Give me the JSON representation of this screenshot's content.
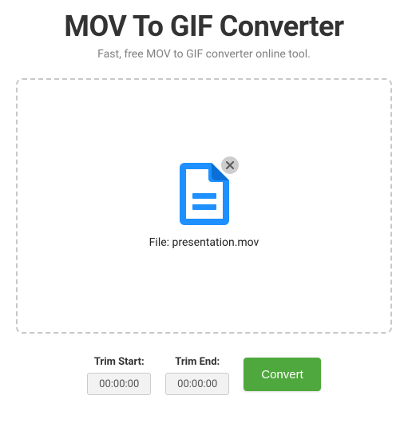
{
  "header": {
    "title": "MOV To GIF Converter",
    "subtitle": "Fast, free MOV to GIF converter online tool."
  },
  "dropzone": {
    "file_prefix": "File: ",
    "file_name": "presentation.mov"
  },
  "controls": {
    "trim_start_label": "Trim Start:",
    "trim_start_value": "00:00:00",
    "trim_end_label": "Trim End:",
    "trim_end_value": "00:00:00",
    "convert_label": "Convert"
  },
  "colors": {
    "accent": "#1e90ff",
    "convert": "#4fa83d"
  }
}
